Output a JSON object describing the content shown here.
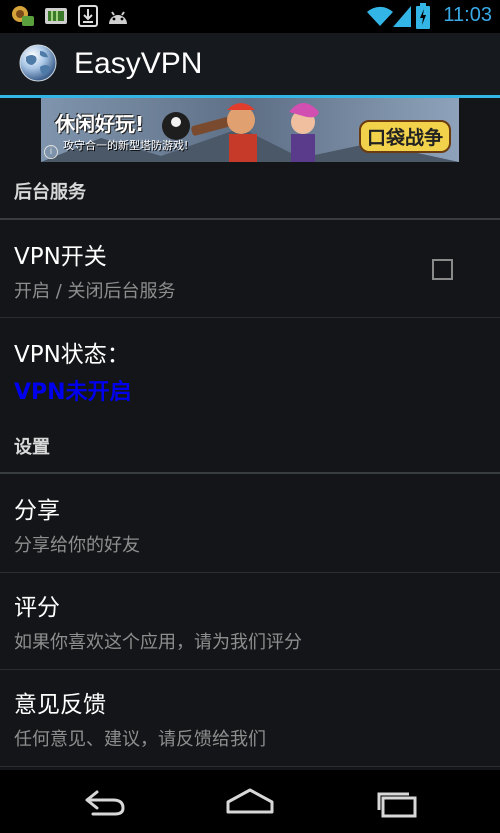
{
  "status_bar": {
    "time": "11:03",
    "icons": [
      "notification-app-icon",
      "battery-app-icon",
      "download-icon",
      "android-icon",
      "wifi-icon",
      "signal-icon",
      "battery-charging-icon"
    ]
  },
  "action_bar": {
    "title": "EasyVPN",
    "logo_icon": "globe-icon"
  },
  "ad": {
    "left_text": "休闲好玩!",
    "sub_text": "攻守合一的新型塔防游戏!",
    "right_text": "口袋战争",
    "info_glyph": "i"
  },
  "sections": {
    "background_service": {
      "header": "后台服务",
      "vpn_switch": {
        "title": "VPN开关",
        "summary": "开启 / 关闭后台服务",
        "checked": false
      },
      "vpn_status": {
        "title": "VPN状态：",
        "value": "VPN未开启",
        "value_color": "#0000ee"
      }
    },
    "settings": {
      "header": "设置",
      "share": {
        "title": "分享",
        "summary": "分享给你的好友"
      },
      "rate": {
        "title": "评分",
        "summary": "如果你喜欢这个应用，请为我们评分"
      },
      "feedback": {
        "title": "意见反馈",
        "summary": "任何意见、建议，请反馈给我们"
      }
    }
  },
  "nav_bar": {
    "back_icon": "back-icon",
    "home_icon": "home-icon",
    "recents_icon": "recents-icon"
  },
  "colors": {
    "accent": "#33b5e5",
    "time": "#3aa9e6",
    "background": "#131518"
  }
}
